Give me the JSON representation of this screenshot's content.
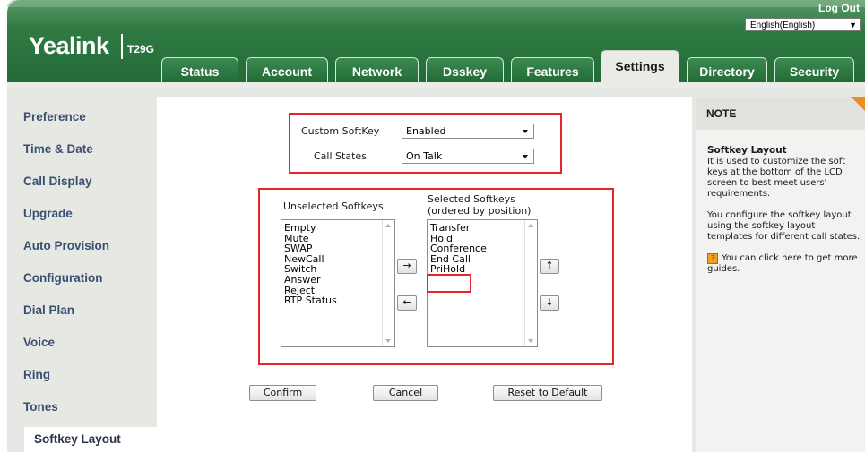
{
  "header": {
    "logo": "Yealink",
    "model": "T29G",
    "logout": "Log Out",
    "language": "English(English)"
  },
  "tabs": [
    {
      "label": "Status"
    },
    {
      "label": "Account"
    },
    {
      "label": "Network"
    },
    {
      "label": "Dsskey"
    },
    {
      "label": "Features"
    },
    {
      "label": "Settings"
    },
    {
      "label": "Directory"
    },
    {
      "label": "Security"
    }
  ],
  "active_tab": "Settings",
  "sidebar": {
    "items": [
      {
        "label": "Preference"
      },
      {
        "label": "Time & Date"
      },
      {
        "label": "Call Display"
      },
      {
        "label": "Upgrade"
      },
      {
        "label": "Auto Provision"
      },
      {
        "label": "Configuration"
      },
      {
        "label": "Dial Plan"
      },
      {
        "label": "Voice"
      },
      {
        "label": "Ring"
      },
      {
        "label": "Tones"
      },
      {
        "label": "Softkey Layout"
      }
    ],
    "active": "Softkey Layout"
  },
  "form": {
    "custom_softkey_label": "Custom SoftKey",
    "custom_softkey_value": "Enabled",
    "call_states_label": "Call States",
    "call_states_value": "On Talk",
    "unselected_title": "Unselected Softkeys",
    "selected_title_line1": "Selected Softkeys",
    "selected_title_line2": "(ordered by position)",
    "unselected_items": [
      "Empty",
      "Mute",
      "SWAP",
      "NewCall",
      "Switch",
      "Answer",
      "Reject",
      "RTP Status"
    ],
    "selected_items": [
      "Transfer",
      "Hold",
      "Conference",
      "End Call",
      "PriHold"
    ],
    "move_right": "→",
    "move_left": "←",
    "move_up": "↑",
    "move_down": "↓",
    "confirm": "Confirm",
    "cancel": "Cancel",
    "reset": "Reset to Default"
  },
  "note": {
    "heading": "NOTE",
    "title": "Softkey Layout",
    "text1": "It is used to customize the soft keys at the bottom of the LCD screen to best meet users' requirements.",
    "text2": "You configure the softkey layout using the softkey layout templates for different call states.",
    "text3": "You can click here to get more guides."
  },
  "colors": {
    "header_green": "#236b37",
    "sidebar_text": "#3b4f73",
    "highlight_red": "#e3262a",
    "note_corner": "#f08a24"
  }
}
